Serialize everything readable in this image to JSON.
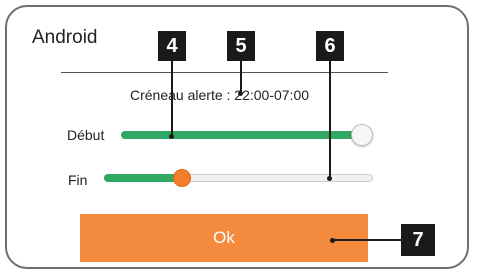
{
  "dialog": {
    "title": "Android",
    "subtitle": "Créneau alerte : 22:00-07:00",
    "start_label": "Début",
    "end_label": "Fin",
    "ok_label": "Ok",
    "start_slider_value": 1.0,
    "end_slider_value": 0.29
  },
  "callouts": {
    "c4": "4",
    "c5": "5",
    "c6": "6",
    "c7": "7"
  },
  "colors": {
    "slider_fill": "#2fa866",
    "end_thumb": "#f47d2d",
    "ok_button": "#f38a3d",
    "callout_bg": "#1a1a1a"
  }
}
